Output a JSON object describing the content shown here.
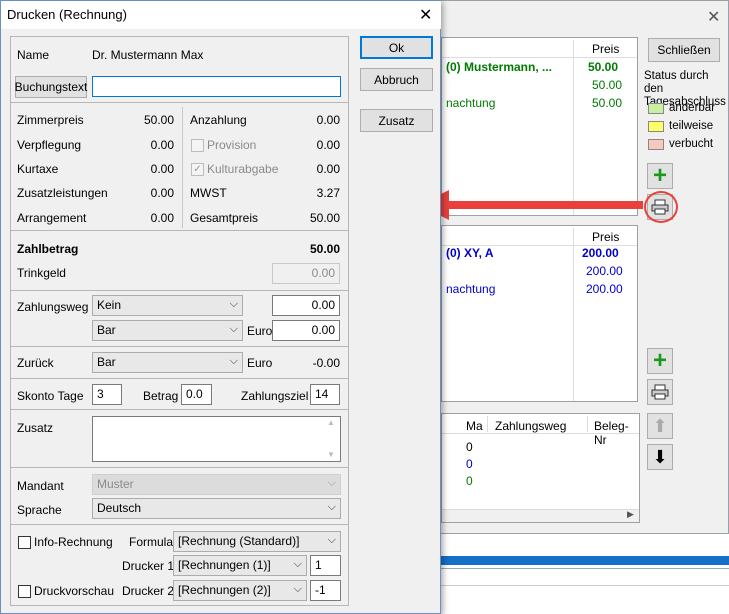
{
  "dialog": {
    "title": "Drucken (Rechnung)",
    "name_label": "Name",
    "name_value": "Dr. Mustermann Max",
    "buchungstext_button": "Buchungstext",
    "buchungstext_value": "",
    "ok_label": "Ok",
    "abbruch_label": "Abbruch",
    "zusatz_button_label": "Zusatz",
    "left_items": [
      {
        "label": "Zimmerpreis",
        "value": "50.00"
      },
      {
        "label": "Verpflegung",
        "value": "0.00"
      },
      {
        "label": "Kurtaxe",
        "value": "0.00"
      },
      {
        "label": "Zusatzleistungen",
        "value": "0.00"
      },
      {
        "label": "Arrangement",
        "value": "0.00"
      }
    ],
    "right_items": [
      {
        "label": "Anzahlung",
        "value": "0.00"
      },
      {
        "label": "Provision",
        "value": "0.00"
      },
      {
        "label": "Kulturabgabe",
        "value": "0.00"
      },
      {
        "label": "MWST",
        "value": "3.27"
      },
      {
        "label": "Gesamtpreis",
        "value": "50.00"
      }
    ],
    "zahlbetrag_label": "Zahlbetrag",
    "zahlbetrag_value": "50.00",
    "trinkgeld_label": "Trinkgeld",
    "trinkgeld_value": "0.00",
    "zahlungsweg_label": "Zahlungsweg",
    "zahlungsweg1_value": "Kein",
    "zahlungsweg1_amount": "0.00",
    "zahlungsweg2_value": "Bar",
    "euro_label": "Euro",
    "zahlungsweg2_amount": "0.00",
    "zurueck_label": "Zurück",
    "zurueck_value": "Bar",
    "zurueck_euro_label": "Euro",
    "zurueck_amount": "-0.00",
    "skonto_label": "Skonto Tage",
    "skonto_value": "3",
    "betrag_label": "Betrag",
    "betrag_value": "0.0",
    "zahlungsziel_label": "Zahlungsziel",
    "zahlungsziel_value": "14",
    "zusatz_label": "Zusatz",
    "zusatz_value": "",
    "mandant_label": "Mandant",
    "mandant_value": "Muster",
    "sprache_label": "Sprache",
    "sprache_value": "Deutsch",
    "info_rechnung_label": "Info-Rechnung",
    "formular_label": "Formular",
    "formular_value": "[Rechnung (Standard)]",
    "drucker1_label": "Drucker 1",
    "drucker1_value": "[Rechnungen (1)]",
    "drucker1_copies": "1",
    "druckvorschau_label": "Druckvorschau",
    "drucker2_label": "Drucker 2",
    "drucker2_value": "[Rechnungen (2)]",
    "drucker2_copies": "-1"
  },
  "background": {
    "schliessen_label": "Schließen",
    "status_title": "Status durch den Tagesabschluss",
    "status_legend": [
      {
        "label": "änderbar",
        "color": "#c8f0a0"
      },
      {
        "label": "teilweise",
        "color": "#ffff66"
      },
      {
        "label": "verbucht",
        "color": "#f8c8c0"
      }
    ],
    "panel1": {
      "header": "Preis",
      "rows": [
        {
          "name": "(0) Mustermann, ...",
          "price": "50.00",
          "bold": true
        },
        {
          "name": "",
          "price": "50.00",
          "bold": false
        },
        {
          "name": "nachtung",
          "price": "50.00",
          "bold": false
        }
      ]
    },
    "panel2": {
      "header": "Preis",
      "rows": [
        {
          "name": "(0) XY, A",
          "price": "200.00",
          "bold": true
        },
        {
          "name": "",
          "price": "200.00",
          "bold": false
        },
        {
          "name": "nachtung",
          "price": "200.00",
          "bold": false
        }
      ]
    },
    "panel3": {
      "headers": [
        "Ma",
        "Zahlungsweg",
        "Beleg-Nr"
      ],
      "values": [
        "0",
        "0",
        "0"
      ]
    },
    "colors": {
      "green": "#007a00",
      "blue": "#0000c8",
      "arrow": "#e8413c"
    }
  }
}
